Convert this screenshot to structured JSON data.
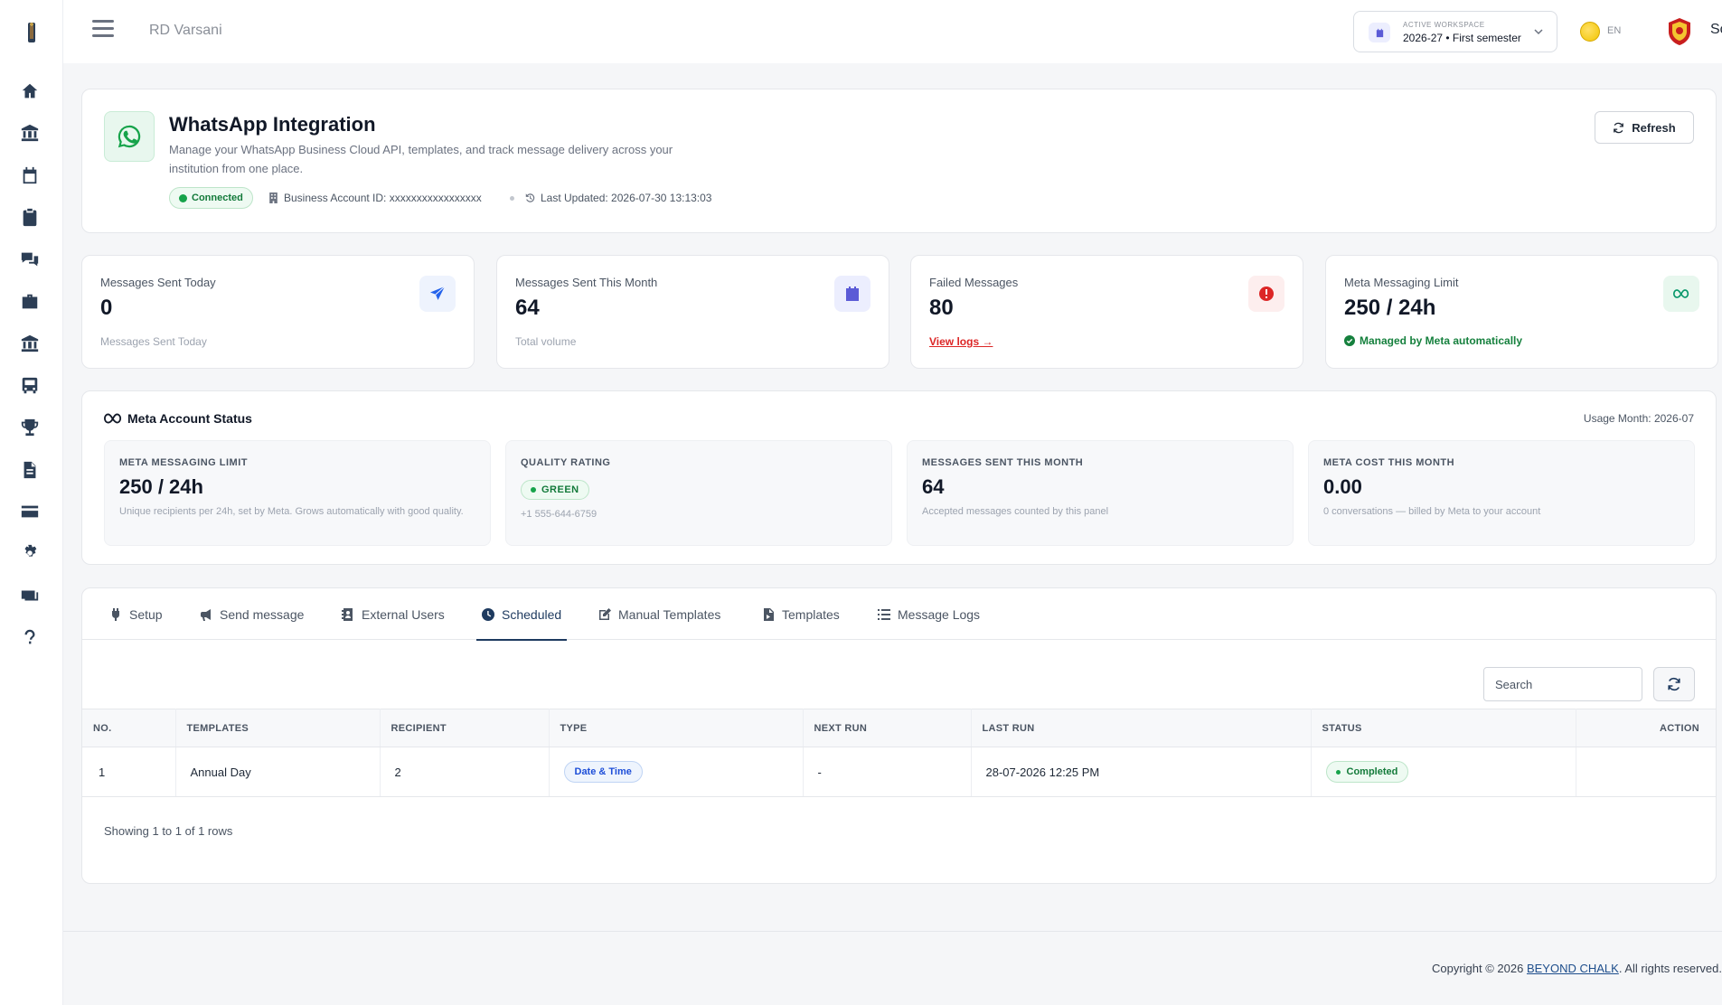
{
  "topbar": {
    "org_name": "RD Varsani",
    "workspace_label": "ACTIVE WORKSPACE",
    "workspace_value": "2026-27 • First semester",
    "language": "EN",
    "school": "School"
  },
  "sidebar": {
    "items": [
      "home-icon",
      "bank-icon",
      "calendar-icon",
      "clipboard-icon",
      "chat-icon",
      "briefcase-icon",
      "institution-icon",
      "bus-icon",
      "trophy-icon",
      "document-icon",
      "card-icon",
      "gear-icon",
      "money-icon",
      "help-icon"
    ]
  },
  "header": {
    "title": "WhatsApp Integration",
    "description": "Manage your WhatsApp Business Cloud API, templates, and track message delivery across your institution from one place.",
    "status": "Connected",
    "business_account": "Business Account ID: xxxxxxxxxxxxxxxxx",
    "last_updated": "Last Updated: 2026-07-30 13:13:03",
    "refresh_label": "Refresh"
  },
  "stats": [
    {
      "label": "Messages Sent Today",
      "value": "0",
      "sub": "Messages Sent Today",
      "color": "#2563eb",
      "bg": "#eef3fd"
    },
    {
      "label": "Messages Sent This Month",
      "value": "64",
      "sub": "Total volume",
      "color": "#5b5bd6",
      "bg": "#eceefe"
    },
    {
      "label": "Failed Messages",
      "value": "80",
      "link": "View logs →",
      "color": "#dc2626",
      "bg": "#fdeeee"
    },
    {
      "label": "Meta Messaging Limit",
      "value": "250 / 24h",
      "ok": "Managed by Meta automatically",
      "color": "#059669",
      "bg": "#e8f7ee"
    }
  ],
  "meta_status": {
    "title": "Meta Account Status",
    "usage_month": "Usage Month: 2026-07",
    "boxes": [
      {
        "label": "META MESSAGING LIMIT",
        "value": "250 / 24h",
        "note": "Unique recipients per 24h, set by Meta. Grows automatically with good quality."
      },
      {
        "label": "QUALITY RATING",
        "pill": "GREEN",
        "note": "+1 555-644-6759"
      },
      {
        "label": "MESSAGES SENT THIS MONTH",
        "value": "64",
        "note": "Accepted messages counted by this panel"
      },
      {
        "label": "META COST THIS MONTH",
        "value": "0.00",
        "note": "0 conversations — billed by Meta to your account"
      }
    ]
  },
  "tabs": [
    "Setup",
    "Send message",
    "External Users",
    "Scheduled",
    "Manual Templates",
    "Templates",
    "Message Logs"
  ],
  "active_tab": "Scheduled",
  "search": {
    "placeholder": "Search"
  },
  "table": {
    "columns": [
      "NO.",
      "TEMPLATES",
      "RECIPIENT",
      "TYPE",
      "NEXT RUN",
      "LAST RUN",
      "STATUS",
      "ACTION"
    ],
    "rows": [
      {
        "no": "1",
        "template": "Annual Day",
        "recipient": "2",
        "type": "Date & Time",
        "next_run": "-",
        "last_run": "28-07-2026 12:25 PM",
        "status": "Completed"
      }
    ],
    "showing": "Showing 1 to 1 of 1 rows"
  },
  "footer": {
    "prefix": "Copyright © 2026 ",
    "brand": "BEYOND CHALK",
    "suffix": ". All rights reserved."
  }
}
